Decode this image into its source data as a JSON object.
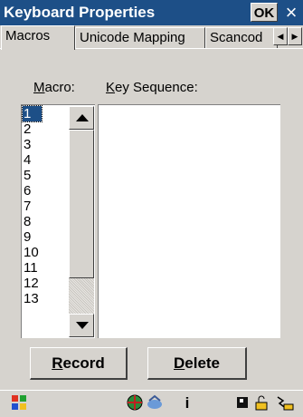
{
  "window": {
    "title": "Keyboard Properties",
    "ok_label": "OK",
    "close_label": "×"
  },
  "tabs": [
    {
      "label": "Macros",
      "active": true
    },
    {
      "label": "Unicode Mapping",
      "active": false
    },
    {
      "label": "Scancod",
      "active": false
    }
  ],
  "tab_scroll": {
    "left_icon": "chevron-left-icon",
    "right_icon": "chevron-right-icon"
  },
  "macros_panel": {
    "macro_label_prefix": "M",
    "macro_label_rest": "acro:",
    "keyseq_label_prefix": "K",
    "keyseq_label_rest": "ey Sequence:",
    "macro_items": [
      "1",
      "2",
      "3",
      "4",
      "5",
      "6",
      "7",
      "8",
      "9",
      "10",
      "11",
      "12",
      "13"
    ],
    "selected_macro": "1",
    "key_sequence": ""
  },
  "buttons": {
    "record_prefix": "R",
    "record_rest": "ecord",
    "delete_prefix": "D",
    "delete_rest": "elete"
  },
  "taskbar": {
    "icons": [
      "start-flag-icon",
      "network-globe-icon",
      "bluetooth-icon",
      "info-icon",
      "battery-icon",
      "keyboard-lock-icon",
      "input-panel-icon"
    ]
  },
  "colors": {
    "titlebar": "#1d4f87",
    "face": "#d6d3ce",
    "selection": "#1d4f87"
  }
}
